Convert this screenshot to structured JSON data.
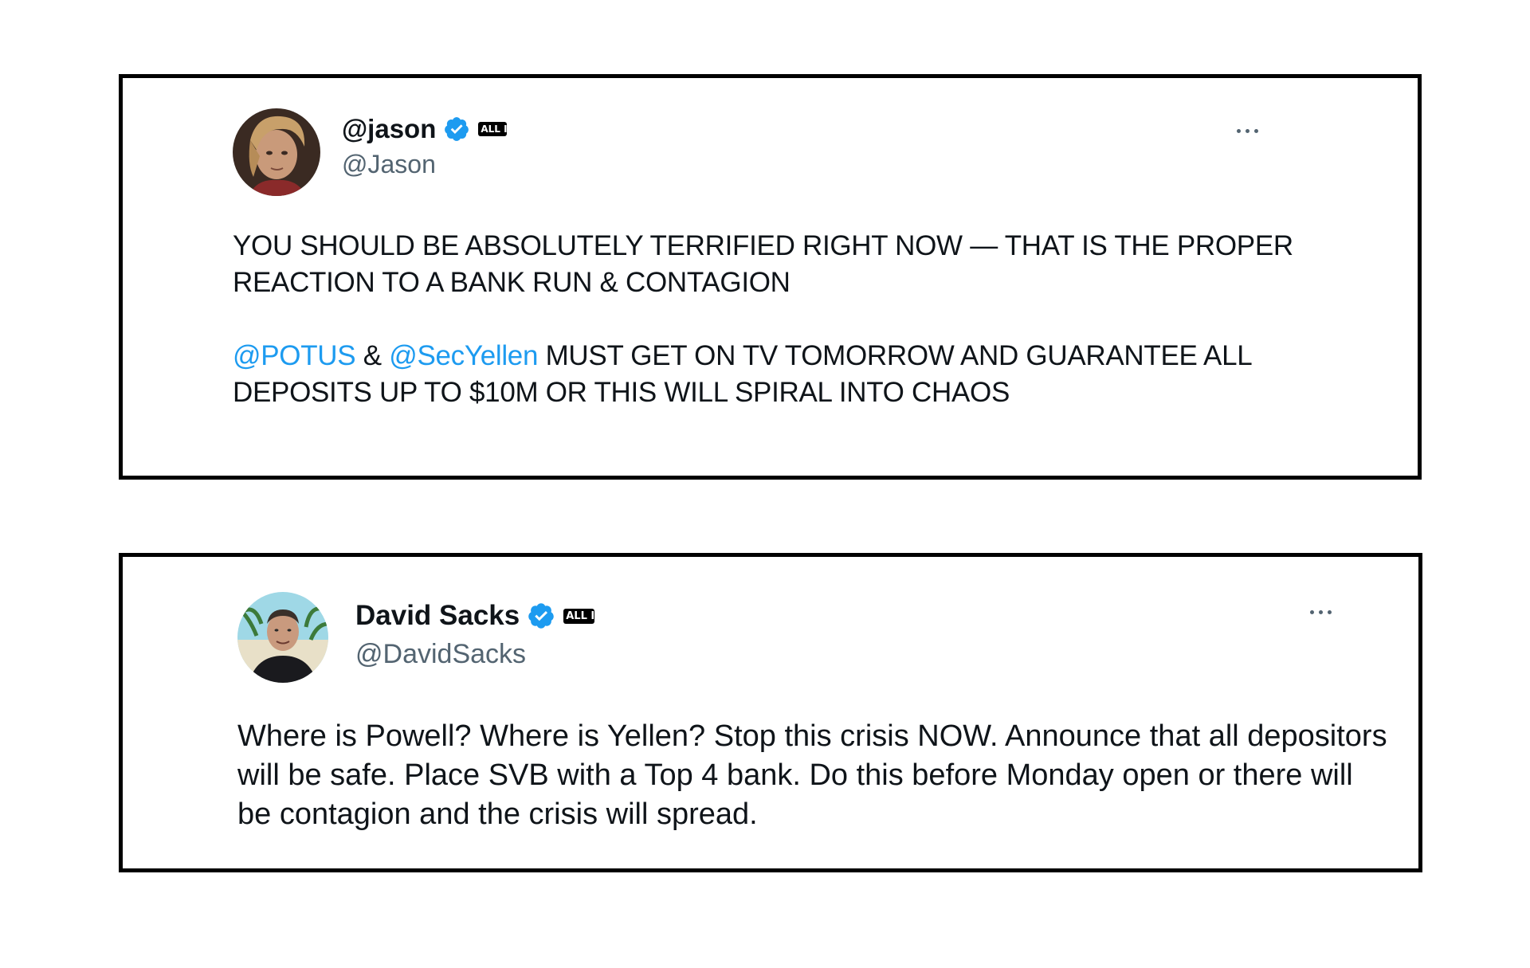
{
  "tweets": [
    {
      "display_name": "@jason",
      "handle": "@Jason",
      "verified_icon": "verified-badge-icon",
      "affiliate_badge": "ALL IN",
      "more_icon": "more-options-icon",
      "text": {
        "line1": "YOU SHOULD BE ABSOLUTELY TERRIFIED RIGHT NOW  — THAT IS THE PROPER REACTION TO A BANK RUN & CONTAGION",
        "mention_potus": "@POTUS",
        "amp": " & ",
        "mention_secyellen": "@SecYellen",
        "line2_rest": " MUST GET ON TV TOMORROW AND GUARANTEE ALL DEPOSITS UP TO $10M OR THIS WILL SPIRAL INTO CHAOS"
      }
    },
    {
      "display_name": "David Sacks",
      "handle": "@DavidSacks",
      "verified_icon": "verified-badge-icon",
      "affiliate_badge": "ALL IN",
      "more_icon": "more-options-icon",
      "text": "Where is Powell? Where is Yellen? Stop this crisis NOW. Announce that all depositors will be safe. Place SVB with a Top 4 bank. Do this before Monday open or there will be contagion and the crisis will spread."
    }
  ],
  "colors": {
    "mention": "#1d9bf0",
    "verified": "#1d9bf0",
    "handle": "#536471",
    "text": "#0f1419",
    "frame_border": "#000000"
  }
}
